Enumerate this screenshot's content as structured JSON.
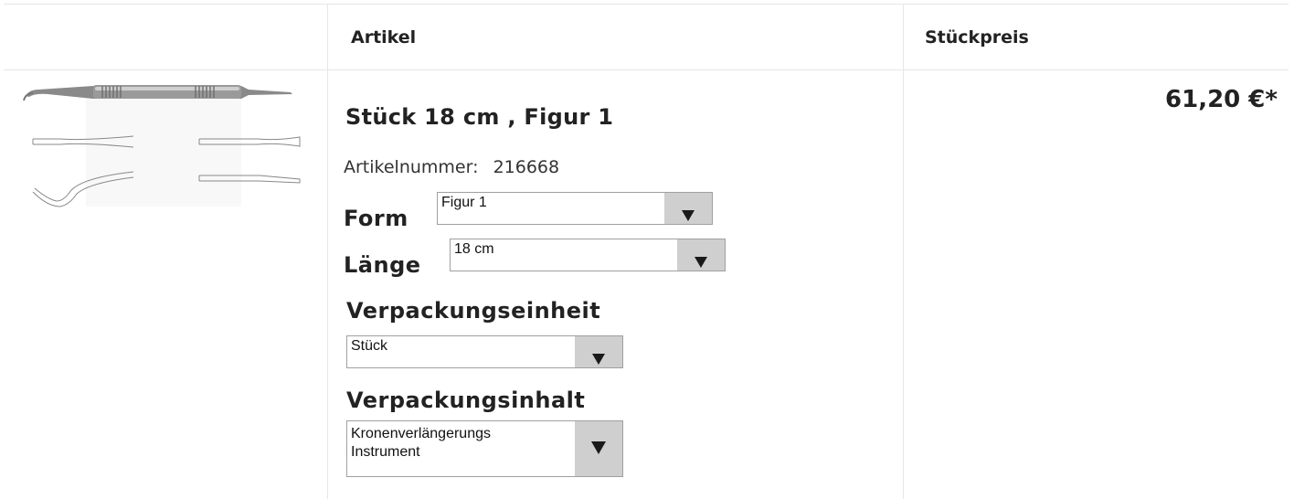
{
  "table": {
    "headers": {
      "image": "",
      "artikel": "Artikel",
      "stueckpreis": "Stückpreis"
    }
  },
  "product": {
    "title": "Stück 18 cm , Figur 1",
    "artikelnummer_label": "Artikelnummer:",
    "artikelnummer_value": "216668",
    "image_icon": "dental-instrument-image",
    "price": "61,20 €*",
    "options": {
      "form": {
        "label": "Form",
        "selected": "Figur 1"
      },
      "laenge": {
        "label": "Länge",
        "selected": "18 cm"
      },
      "verpackungseinheit": {
        "label": "Verpackungseinheit",
        "selected": "Stück"
      },
      "verpackungsinhalt": {
        "label": "Verpackungsinhalt",
        "selected_line1": "Kronenverlängerungs",
        "selected_line2": "Instrument"
      }
    }
  },
  "colors": {
    "border": "#e6e6e6",
    "select_button": "#cfcfcf",
    "text": "#222222"
  }
}
